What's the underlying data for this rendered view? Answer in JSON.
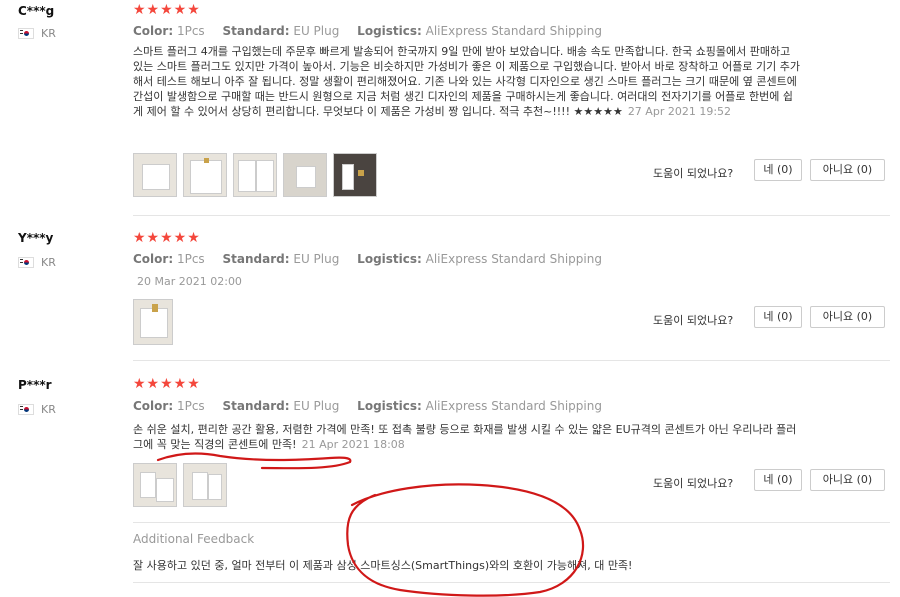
{
  "helpful_label": "도움이 되었나요?",
  "reviews": [
    {
      "user": "C***g",
      "country": "KR",
      "stars": "★★★★★",
      "color_label": "Color:",
      "color_value": "1Pcs",
      "standard_label": "Standard:",
      "standard_value": "EU Plug",
      "logistics_label": "Logistics:",
      "logistics_value": "AliExpress Standard Shipping",
      "text": "스마트 플러그 4개를 구입했는데 주문후 빠르게 발송되어 한국까지 9일 만에 받아 보았습니다. 배송 속도 만족합니다. 한국 쇼핑몰에서 판매하고 있는 스마트 플러그도 있지만 가격이 높아서. 기능은 비슷하지만 가성비가 좋은 이 제품으로 구입했습니다. 받아서 바로 장착하고 어플로 기기 추가해서 테스트 해보니 아주 잘 됩니다. 정말 생활이 편리해졌어요. 기존 나와 있는 사각형 디자인으로 생긴 스마트 플러그는 크기 때문에 옆 콘센트에 간섭이 발생함으로 구매할 때는 반드시 원형으로 지금 처럼 생긴 디자인의 제품을 구매하시는게 좋습니다. 여러대의 전자기기를 어플로 한번에 쉽게 제어 할 수 있어서 상당히 편리합니다. 무엇보다 이 제품은 가성비 짱 입니다. 적극 추천~!!!! ★★★★★",
      "date": "27 Apr 2021 19:52",
      "yes": "네 (0)",
      "no": "아니요 (0)"
    },
    {
      "user": "Y***y",
      "country": "KR",
      "stars": "★★★★★",
      "color_label": "Color:",
      "color_value": "1Pcs",
      "standard_label": "Standard:",
      "standard_value": "EU Plug",
      "logistics_label": "Logistics:",
      "logistics_value": "AliExpress Standard Shipping",
      "date": "20 Mar 2021 02:00",
      "yes": "네 (0)",
      "no": "아니요 (0)"
    },
    {
      "user": "P***r",
      "country": "KR",
      "stars": "★★★★★",
      "color_label": "Color:",
      "color_value": "1Pcs",
      "standard_label": "Standard:",
      "standard_value": "EU Plug",
      "logistics_label": "Logistics:",
      "logistics_value": "AliExpress Standard Shipping",
      "text": "손 쉬운 설치, 편리한 공간 활용, 저렴한 가격에 만족! 또 접촉 불량 등으로 화재를 발생 시킬 수 있는 얇은 EU규격의 콘센트가 아닌 우리나라 플러그에 꼭 맞는 직경의 콘센트에 만족!",
      "date": "21 Apr 2021 18:08",
      "yes": "네 (0)",
      "no": "아니요 (0)",
      "additional_title": "Additional Feedback",
      "additional_text": "잘 사용하고 있던 중, 얼마 전부터 이 제품과 삼성 스마트싱스(SmartThings)와의 호환이 가능해져, 대 만족!"
    }
  ],
  "annotation_color": "#d01818"
}
